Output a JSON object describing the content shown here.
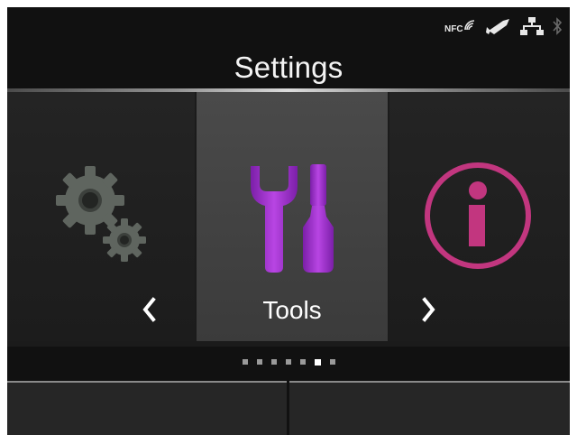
{
  "status_bar": {
    "nfc_label": "NFC",
    "icons": [
      "nfc-icon",
      "scanner-icon",
      "network-icon",
      "bluetooth-icon"
    ]
  },
  "header": {
    "title": "Settings"
  },
  "carousel": {
    "items": [
      {
        "icon": "gears-icon",
        "label": ""
      },
      {
        "icon": "tools-icon",
        "label": "Tools"
      },
      {
        "icon": "info-icon",
        "label": ""
      }
    ],
    "selected_index": 1,
    "prev_arrow": "‹",
    "next_arrow": "›"
  },
  "pager": {
    "total": 7,
    "active_index": 5
  },
  "softkeys": {
    "left_label": "",
    "right_label": ""
  },
  "colors": {
    "accent_purple": "#a23bd1",
    "info_pink": "#c2367f",
    "gear_gray": "#5f655f"
  }
}
